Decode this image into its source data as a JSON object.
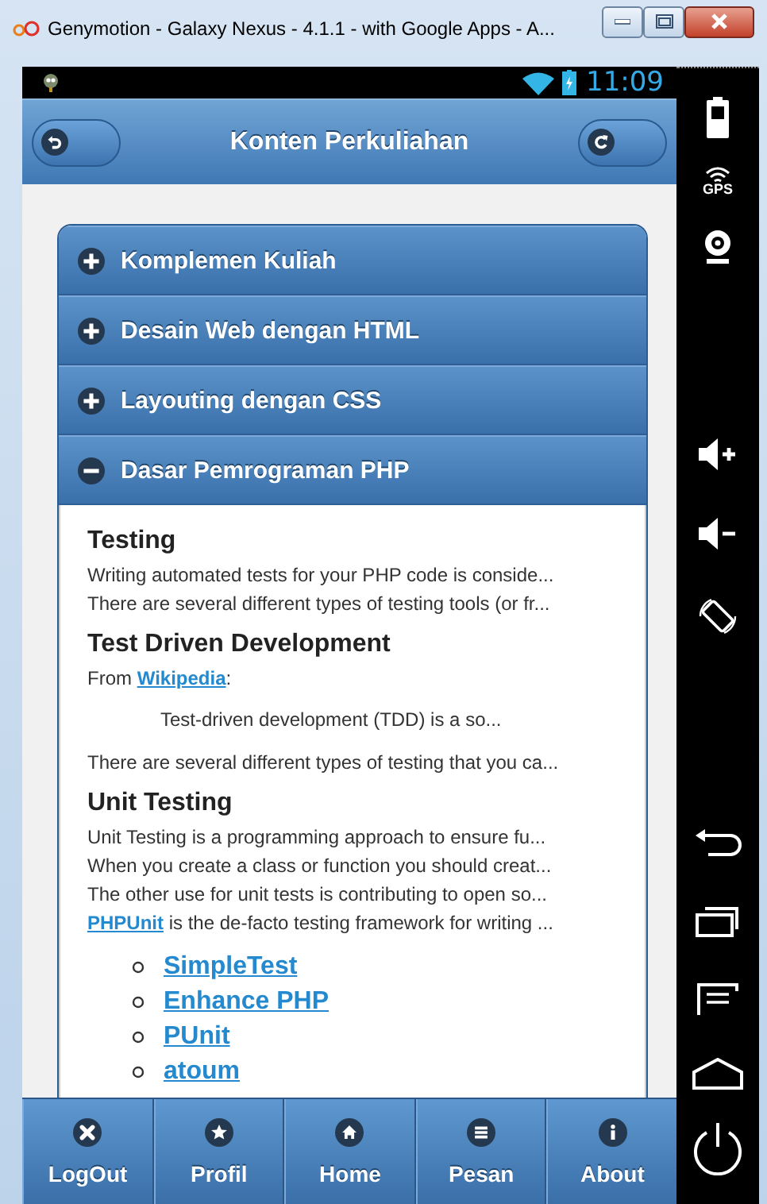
{
  "window": {
    "title": "Genymotion - Galaxy Nexus - 4.1.1 - with Google Apps - A..."
  },
  "status_bar": {
    "time": "11:09"
  },
  "header": {
    "title": "Konten Perkuliahan"
  },
  "collapsibles": [
    {
      "title": "Komplemen Kuliah",
      "expanded": false
    },
    {
      "title": "Desain Web dengan HTML",
      "expanded": false
    },
    {
      "title": "Layouting dengan CSS",
      "expanded": false
    },
    {
      "title": "Dasar Pemrograman PHP",
      "expanded": true
    }
  ],
  "content": [
    {
      "kind": "heading",
      "text": "Testing"
    },
    {
      "kind": "line",
      "parts": [
        {
          "kind": "text",
          "text": "Writing automated tests for your PHP code is conside..."
        }
      ]
    },
    {
      "kind": "line",
      "parts": [
        {
          "kind": "text",
          "text": "There are several different types of testing tools (or fr..."
        }
      ]
    },
    {
      "kind": "heading",
      "text": "Test Driven Development"
    },
    {
      "kind": "line",
      "parts": [
        {
          "kind": "text",
          "text": "From "
        },
        {
          "kind": "link",
          "text": "Wikipedia"
        },
        {
          "kind": "text",
          "text": ":"
        }
      ]
    },
    {
      "kind": "quote",
      "text": "Test-driven development (TDD) is a so..."
    },
    {
      "kind": "line",
      "parts": [
        {
          "kind": "text",
          "text": "There are several different types of testing that you ca..."
        }
      ]
    },
    {
      "kind": "heading",
      "text": "Unit Testing"
    },
    {
      "kind": "line",
      "parts": [
        {
          "kind": "text",
          "text": "Unit Testing is a programming approach to ensure fu..."
        }
      ]
    },
    {
      "kind": "line",
      "parts": [
        {
          "kind": "text",
          "text": "When you create a class or function you should creat..."
        }
      ]
    },
    {
      "kind": "line",
      "parts": [
        {
          "kind": "text",
          "text": "The other use for unit tests is contributing to open so..."
        }
      ]
    },
    {
      "kind": "line",
      "parts": [
        {
          "kind": "link",
          "text": "PHPUnit"
        },
        {
          "kind": "text",
          "text": " is the de-facto testing framework for writing ..."
        }
      ]
    },
    {
      "kind": "list",
      "items": [
        "SimpleTest",
        "Enhance PHP",
        "PUnit",
        "atoum"
      ]
    }
  ],
  "navbar": [
    {
      "label": "LogOut"
    },
    {
      "label": "Profil"
    },
    {
      "label": "Home"
    },
    {
      "label": "Pesan"
    },
    {
      "label": "About"
    }
  ],
  "side_panel": {
    "gps_label": "GPS"
  }
}
